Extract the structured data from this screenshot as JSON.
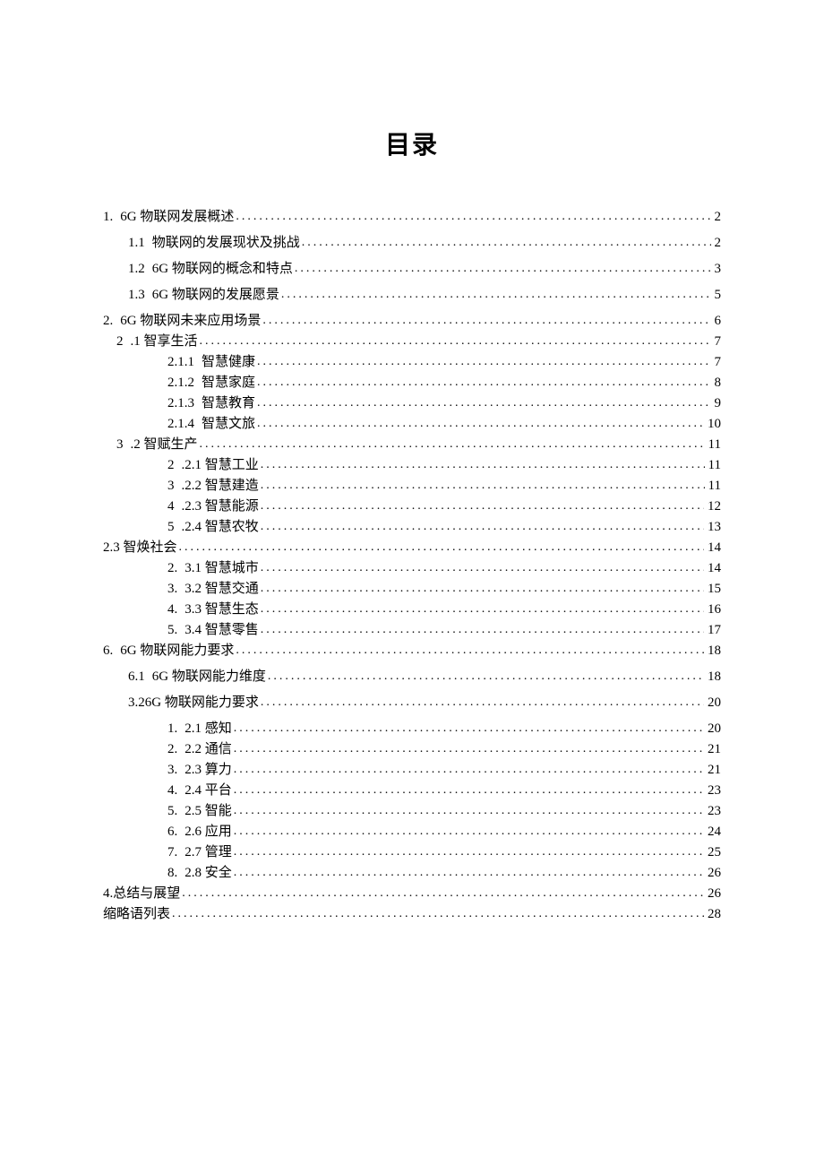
{
  "title": "目录",
  "leader": "........................................................................................................................",
  "toc": [
    {
      "lvl": "lvl0",
      "num": "1.",
      "label": "6G 物联网发展概述",
      "page": "2"
    },
    {
      "lvl": "lvl1",
      "num": "1.1",
      "label": "物联网的发展现状及挑战",
      "page": "2"
    },
    {
      "lvl": "lvl1",
      "num": "1.2",
      "label": "6G 物联网的概念和特点",
      "page": "3"
    },
    {
      "lvl": "lvl1",
      "num": "1.3",
      "label": "6G 物联网的发展愿景",
      "page": "5"
    },
    {
      "lvl": "lvl0",
      "num": "2.",
      "label": "6G 物联网未来应用场景",
      "page": "6"
    },
    {
      "lvl": "lvl1b",
      "num": "2",
      "label": ".1 智享生活",
      "page": "7"
    },
    {
      "lvl": "lvl2",
      "num": "2.1.1",
      "label": "智慧健康",
      "page": "7"
    },
    {
      "lvl": "lvl2",
      "num": "2.1.2",
      "label": "智慧家庭",
      "page": "8"
    },
    {
      "lvl": "lvl2",
      "num": "2.1.3",
      "label": "智慧教育",
      "page": "9"
    },
    {
      "lvl": "lvl2",
      "num": "2.1.4",
      "label": "智慧文旅",
      "page": "10"
    },
    {
      "lvl": "lvl1b",
      "num": "3",
      "label": ".2 智赋生产",
      "page": "11"
    },
    {
      "lvl": "lvl2",
      "num": "2",
      "label": ".2.1 智慧工业",
      "page": "11"
    },
    {
      "lvl": "lvl2",
      "num": "3",
      "label": ".2.2 智慧建造",
      "page": "11"
    },
    {
      "lvl": "lvl2",
      "num": "4",
      "label": ".2.3 智慧能源",
      "page": "12"
    },
    {
      "lvl": "lvl2",
      "num": "5",
      "label": ".2.4 智慧农牧",
      "page": "13"
    },
    {
      "lvl": "lvl0c",
      "num": "",
      "label": "2.3 智焕社会",
      "page": "14"
    },
    {
      "lvl": "lvl2",
      "num": "2.",
      "label": "3.1 智慧城市",
      "page": "14"
    },
    {
      "lvl": "lvl2",
      "num": "3.",
      "label": "3.2 智慧交通",
      "page": "15"
    },
    {
      "lvl": "lvl2",
      "num": "4.",
      "label": "3.3 智慧生态",
      "page": "16"
    },
    {
      "lvl": "lvl2",
      "num": "5.",
      "label": "3.4 智慧零售",
      "page": "17"
    },
    {
      "lvl": "lvl0",
      "num": "6.",
      "label": "6G 物联网能力要求",
      "page": "18"
    },
    {
      "lvl": "lvl1",
      "num": "6.1",
      "label": "6G 物联网能力维度",
      "page": "18"
    },
    {
      "lvl": "lvl1",
      "num": "",
      "label": "3.26G 物联网能力要求",
      "page": "20"
    },
    {
      "lvl": "lvl2",
      "num": "1.",
      "label": "2.1 感知",
      "page": "20"
    },
    {
      "lvl": "lvl2",
      "num": "2.",
      "label": "2.2 通信",
      "page": "21"
    },
    {
      "lvl": "lvl2",
      "num": "3.",
      "label": "2.3 算力",
      "page": "21"
    },
    {
      "lvl": "lvl2",
      "num": "4.",
      "label": "2.4 平台",
      "page": "23"
    },
    {
      "lvl": "lvl2",
      "num": "5.",
      "label": "2.5 智能",
      "page": "23"
    },
    {
      "lvl": "lvl2",
      "num": "6.",
      "label": "2.6 应用",
      "page": "24"
    },
    {
      "lvl": "lvl2",
      "num": "7.",
      "label": "2.7 管理",
      "page": "25"
    },
    {
      "lvl": "lvl2",
      "num": "8.",
      "label": "2.8 安全",
      "page": "26"
    },
    {
      "lvl": "lvl0c",
      "num": "",
      "label": "4.总结与展望",
      "page": "26"
    },
    {
      "lvl": "lvl0c",
      "num": "",
      "label": "缩略语列表",
      "page": "28"
    }
  ]
}
